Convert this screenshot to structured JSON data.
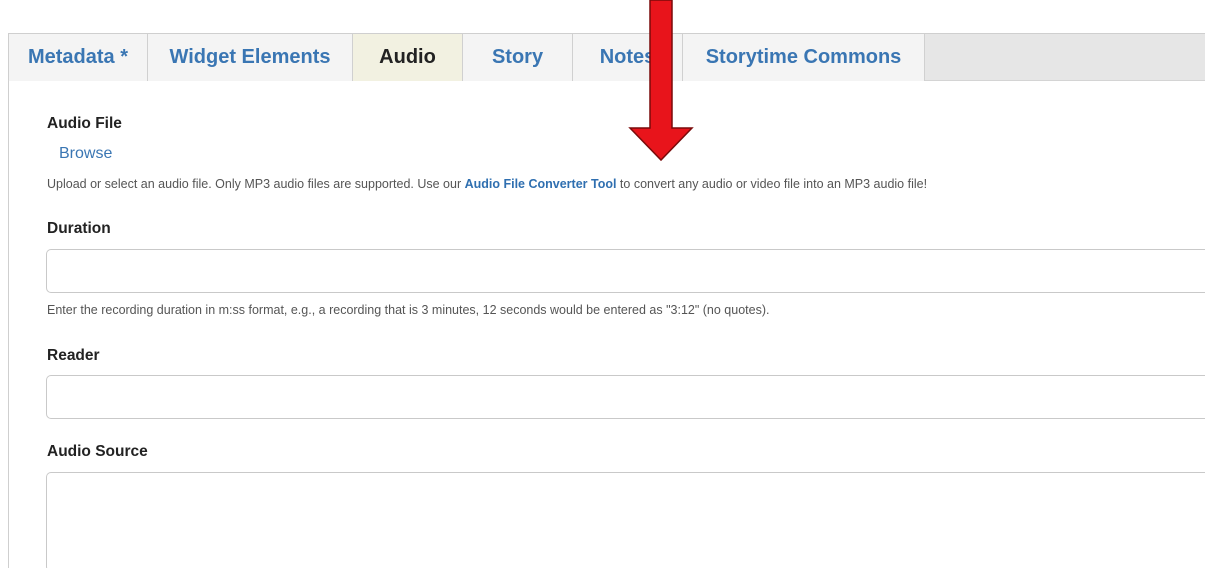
{
  "tabs": [
    {
      "label": "Metadata *",
      "active": false
    },
    {
      "label": "Widget Elements",
      "active": false
    },
    {
      "label": "Audio",
      "active": true
    },
    {
      "label": "Story",
      "active": false
    },
    {
      "label": "Notes",
      "active": false
    },
    {
      "label": "Storytime Commons",
      "active": false
    }
  ],
  "audio_file": {
    "label": "Audio File",
    "browse_label": "Browse",
    "help_before": "Upload or select an audio file. Only MP3 audio files are supported. Use our ",
    "help_link": "Audio File Converter Tool",
    "help_after": " to convert any audio or video file into an MP3 audio file!"
  },
  "duration": {
    "label": "Duration",
    "value": "",
    "help": "Enter the recording duration in m:ss format, e.g., a recording that is 3 minutes, 12 seconds would be entered as \"3:12\" (no quotes)."
  },
  "reader": {
    "label": "Reader",
    "value": ""
  },
  "audio_source": {
    "label": "Audio Source",
    "value": ""
  },
  "colors": {
    "link": "#3a76b3",
    "active_tab": "#f2f1e1",
    "annotation_arrow": "#e8141b"
  },
  "annotation": {
    "icon": "red-down-arrow-icon"
  }
}
